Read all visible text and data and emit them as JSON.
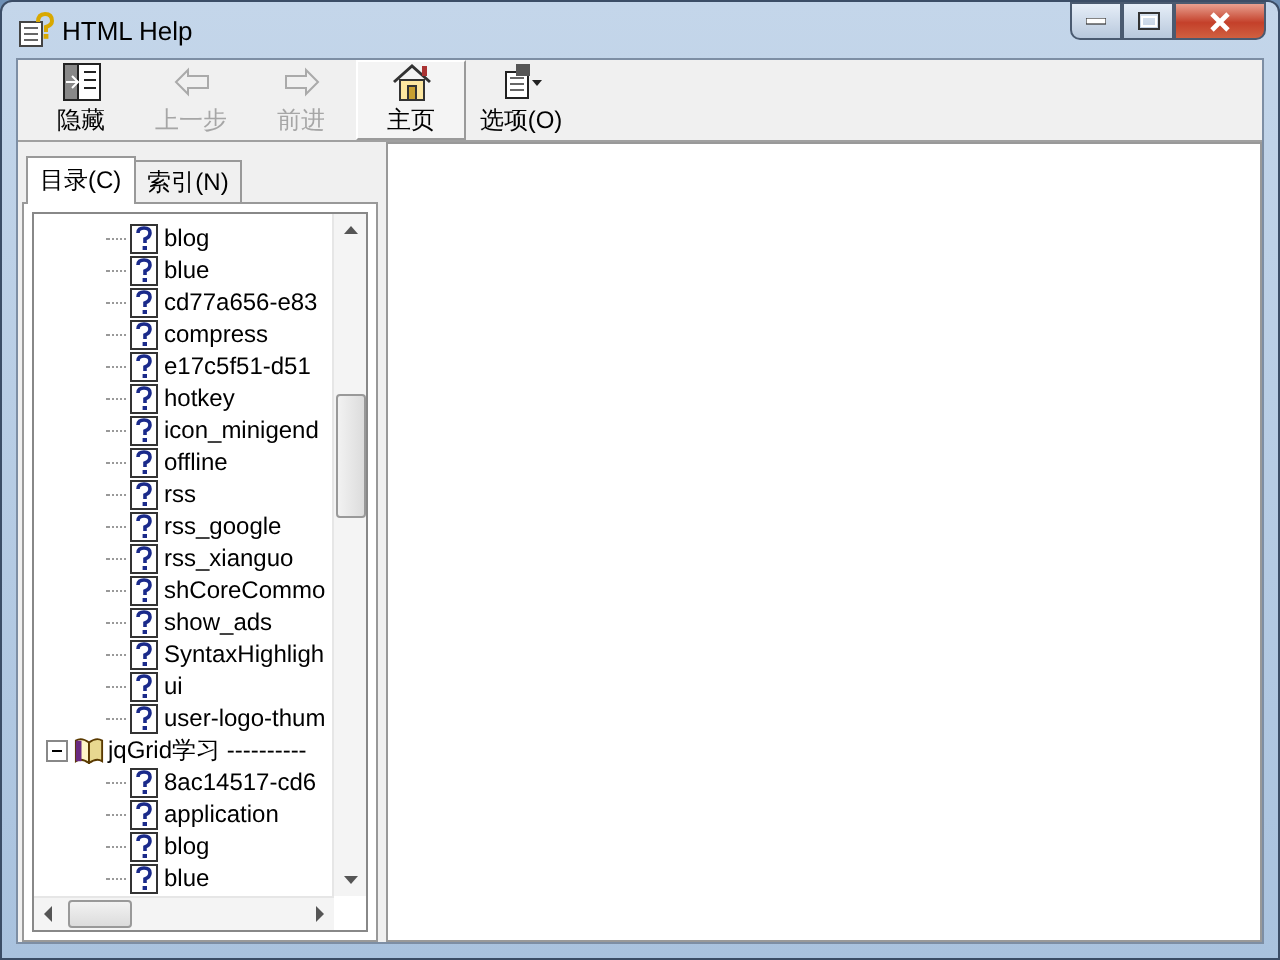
{
  "window": {
    "title": "HTML Help"
  },
  "toolbar": [
    {
      "label": "隐藏",
      "disabled": false,
      "highlighted": false
    },
    {
      "label": "上一步",
      "disabled": true,
      "highlighted": false
    },
    {
      "label": "前进",
      "disabled": true,
      "highlighted": false
    },
    {
      "label": "主页",
      "disabled": false,
      "highlighted": true
    },
    {
      "label": "选项(O)",
      "disabled": false,
      "highlighted": false
    }
  ],
  "tabs": [
    {
      "label": "目录(C)",
      "selected": true
    },
    {
      "label": "索引(N)",
      "selected": false
    }
  ],
  "tree": [
    {
      "children": [
        {
          "label": "blog"
        },
        {
          "label": "blue"
        },
        {
          "label": "cd77a656-e83"
        },
        {
          "label": "compress"
        },
        {
          "label": "e17c5f51-d51"
        },
        {
          "label": "hotkey"
        },
        {
          "label": "icon_minigend"
        },
        {
          "label": "offline"
        },
        {
          "label": "rss"
        },
        {
          "label": "rss_google"
        },
        {
          "label": "rss_xianguo"
        },
        {
          "label": "shCoreCommo"
        },
        {
          "label": "show_ads"
        },
        {
          "label": "SyntaxHighligh"
        },
        {
          "label": "ui"
        },
        {
          "label": "user-logo-thum"
        }
      ]
    },
    {
      "label": "jqGrid学习 ----------",
      "expanded": true,
      "children": [
        {
          "label": "8ac14517-cd6"
        },
        {
          "label": "application"
        },
        {
          "label": "blog"
        },
        {
          "label": "blue"
        }
      ]
    }
  ]
}
